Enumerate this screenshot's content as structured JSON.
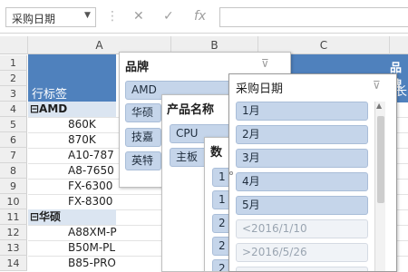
{
  "formula_bar": {
    "name_box": "采购日期",
    "cancel_icon": "✕",
    "enter_icon": "✓",
    "fx_label": "fx"
  },
  "columns": [
    "A",
    "B",
    "C"
  ],
  "rows": [
    "1",
    "2",
    "3",
    "4",
    "5",
    "6",
    "7",
    "8",
    "9",
    "10",
    "11",
    "12",
    "13",
    "14"
  ],
  "pivot": {
    "header": "行标签",
    "lines": [
      {
        "text": "⊟AMD",
        "type": "group"
      },
      {
        "text": "860K",
        "type": "item"
      },
      {
        "text": "870K",
        "type": "item"
      },
      {
        "text": "A10-787",
        "type": "item"
      },
      {
        "text": "A8-7650",
        "type": "item"
      },
      {
        "text": "FX-6300",
        "type": "item"
      },
      {
        "text": "FX-8300",
        "type": "item"
      },
      {
        "text": "⊟华硕",
        "type": "group"
      },
      {
        "text": "A88XM-P",
        "type": "item"
      },
      {
        "text": "B50M-PL",
        "type": "item"
      },
      {
        "text": "B85-PRO",
        "type": "item"
      }
    ]
  },
  "background_fragments": {
    "brand_header_partial": "品牌",
    "right_partial": "长"
  },
  "slicer_brand": {
    "title": "品牌",
    "items": [
      "AMD",
      "华硕",
      "技嘉",
      "英特"
    ]
  },
  "slicer_product": {
    "title": "产品名称",
    "items": [
      "CPU",
      "主板"
    ]
  },
  "slicer_qty": {
    "title": "数",
    "items": [
      "1",
      "1",
      "2",
      "2",
      "2"
    ]
  },
  "slicer_date": {
    "title": "采购日期",
    "items": [
      {
        "label": "1月",
        "state": "selected"
      },
      {
        "label": "2月",
        "state": "selected"
      },
      {
        "label": "3月",
        "state": "selected"
      },
      {
        "label": "4月",
        "state": "selected"
      },
      {
        "label": "5月",
        "state": "selected"
      },
      {
        "label": "<2016/1/10",
        "state": "nodata"
      },
      {
        "label": ">2016/5/26",
        "state": "nodata"
      }
    ]
  },
  "colors": {
    "pivot_header_bg": "#4f81bd",
    "group_row_bg": "#dbe5f1",
    "slicer_selected": "#c5d5ea",
    "slicer_nodata": "#f0f3f7"
  }
}
